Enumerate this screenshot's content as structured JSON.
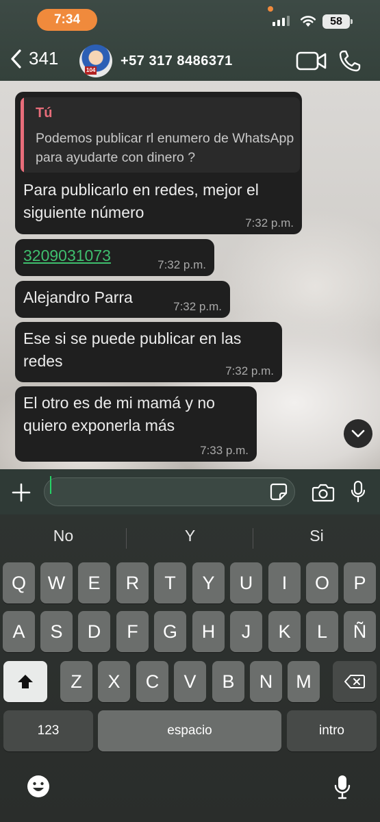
{
  "status_bar": {
    "time": "7:34",
    "battery": "58"
  },
  "header": {
    "back_count": "341",
    "avatar_badge": "104",
    "contact": "+57 317 8486371"
  },
  "messages": [
    {
      "quote_author": "Tú",
      "quote_text": "Podemos publicar rl enumero de WhatsApp para ayudarte con dinero ?",
      "text": "Para publicarlo en redes, mejor el siguiente número",
      "time": "7:32 p.m."
    },
    {
      "text": "3209031073",
      "time": "7:32 p.m."
    },
    {
      "text": "Alejandro Parra",
      "time": "7:32 p.m."
    },
    {
      "text": "Ese si se puede publicar en las redes",
      "time": "7:32 p.m."
    },
    {
      "text": "El otro es de mi mamá y no quiero exponerla más",
      "time": "7:33 p.m."
    }
  ],
  "input": {
    "value": ""
  },
  "keyboard": {
    "suggestions": [
      "No",
      "Y",
      "Si"
    ],
    "row1": [
      "Q",
      "W",
      "E",
      "R",
      "T",
      "Y",
      "U",
      "I",
      "O",
      "P"
    ],
    "row2": [
      "A",
      "S",
      "D",
      "F",
      "G",
      "H",
      "J",
      "K",
      "L",
      "Ñ"
    ],
    "row3": [
      "Z",
      "X",
      "C",
      "V",
      "B",
      "N",
      "M"
    ],
    "numbers_label": "123",
    "space_label": "espacio",
    "return_label": "intro"
  },
  "colors": {
    "accent_green": "#25d366",
    "quote_pink": "#e86d7a",
    "status_orange": "#f08a3c"
  }
}
